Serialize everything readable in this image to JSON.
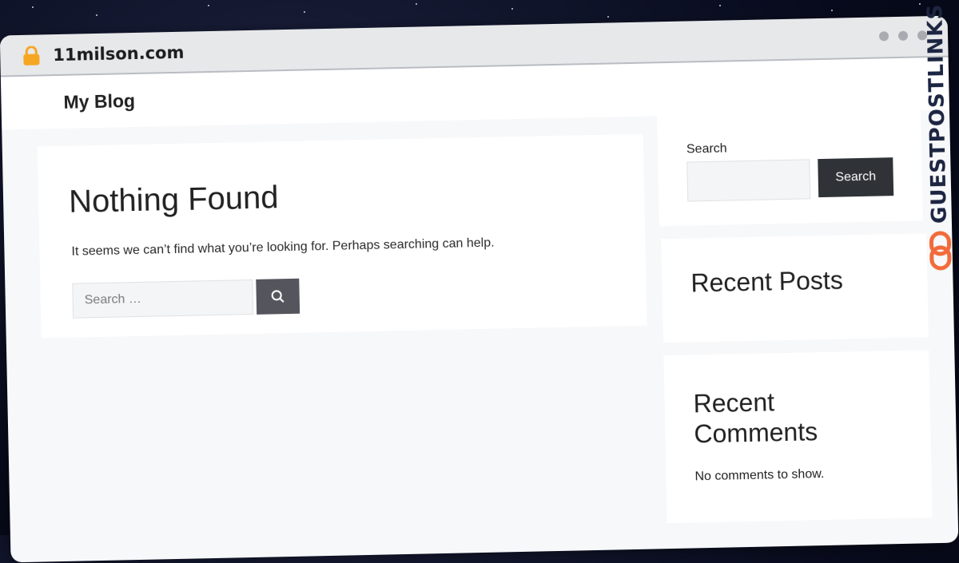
{
  "browser": {
    "url": "11milson.com",
    "lock_icon": "lock-icon",
    "window_dots": 3
  },
  "site": {
    "title": "My Blog"
  },
  "main": {
    "heading": "Nothing Found",
    "message": "It seems we can’t find what you’re looking for. Perhaps searching can help.",
    "search_placeholder": "Search …",
    "search_icon": "search-icon"
  },
  "sidebar": {
    "search_label": "Search",
    "search_button": "Search",
    "recent_posts_title": "Recent Posts",
    "recent_comments_title": "Recent Comments",
    "recent_comments_empty": "No comments to show."
  },
  "watermark": {
    "text": "GUESTPOSTLINKS",
    "icon": "chain-link-icon"
  },
  "colors": {
    "accent_button": "#55555e",
    "sidebar_button": "#2f3337",
    "brand_orange": "#f26b3a",
    "brand_navy": "#1c2541"
  }
}
